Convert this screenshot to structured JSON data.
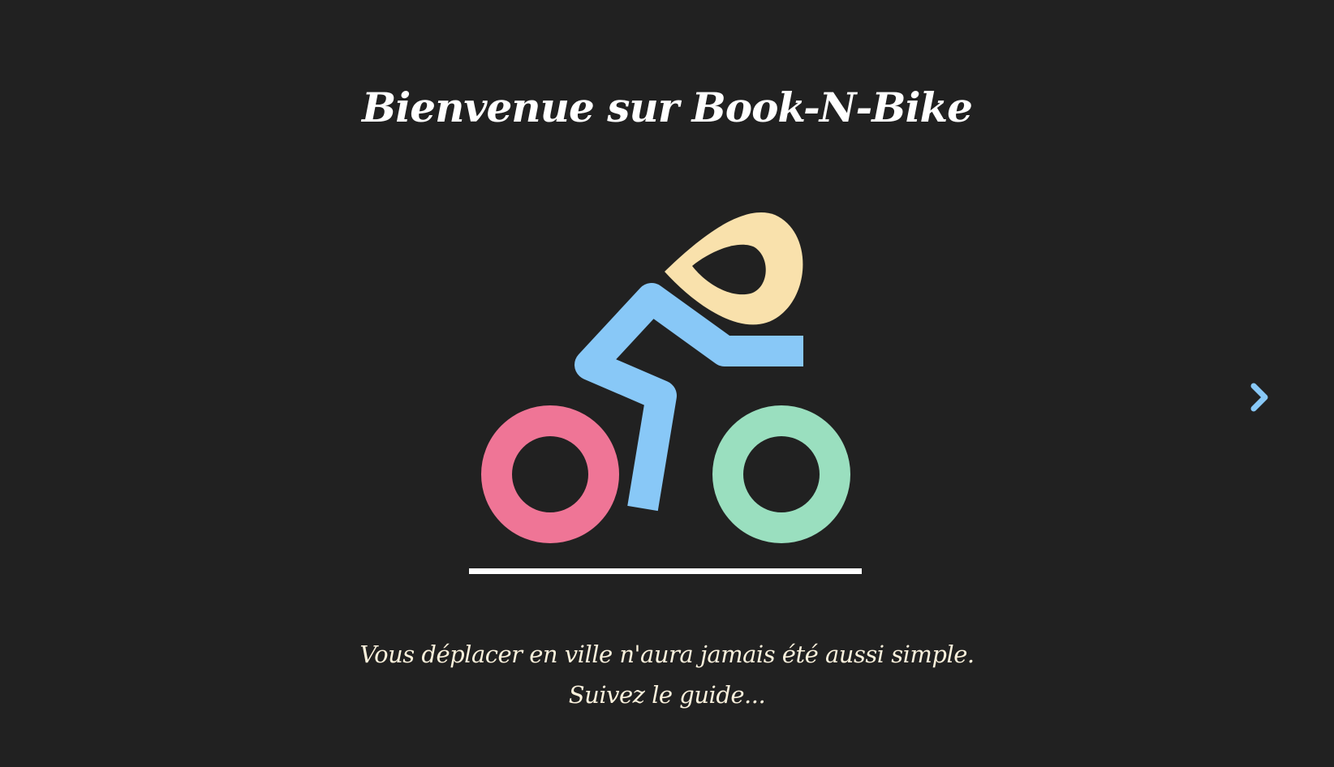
{
  "header": {
    "title": "Bienvenue sur Book-N-Bike"
  },
  "hero": {
    "logo_icon": "cyclist-icon",
    "colors": {
      "head": "#f9e1ac",
      "body": "#88c8f7",
      "rear_wheel": "#ef7596",
      "front_wheel": "#9adfbf",
      "ground": "#ffffff"
    }
  },
  "tagline": {
    "line1": "Vous déplacer en ville n'aura jamais été aussi simple.",
    "line2": "Suivez le guide..."
  },
  "navigation": {
    "next_icon": "chevron-right-icon",
    "color": "#88c8f7"
  },
  "theme": {
    "background": "#212121"
  }
}
